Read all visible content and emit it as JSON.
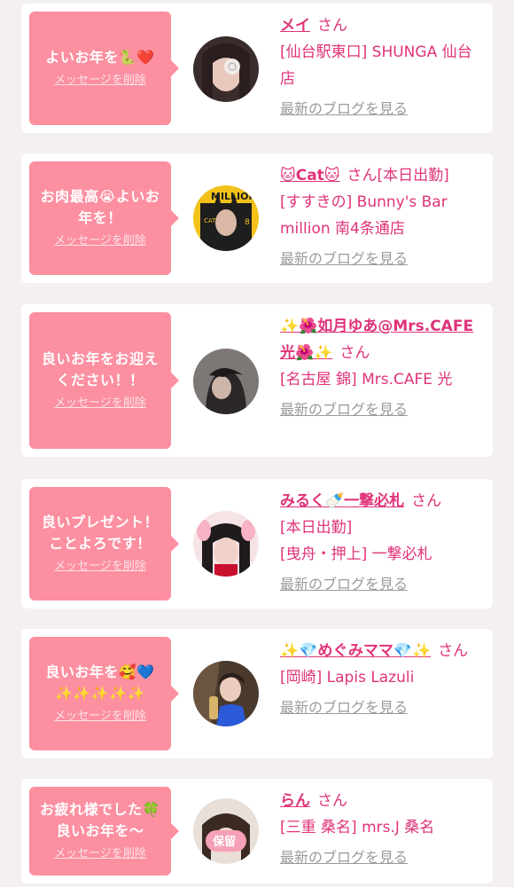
{
  "items": [
    {
      "message": "よいお年を🐍❤️",
      "delete_label": "メッセージを削除",
      "name": "メイ",
      "san": "さん",
      "status": "",
      "shop": "[仙台駅東口] SHUNGA 仙台店",
      "blog_label": "最新のブログを見る",
      "avatar_icon": "profile-photo"
    },
    {
      "message": "お肉最高😭よいお年を！",
      "delete_label": "メッセージを削除",
      "name": "🐱Cat🐱",
      "san": "さん",
      "status": "[本日出勤]",
      "shop": "[すすきの] Bunny's Bar million 南4条通店",
      "blog_label": "最新のブログを見る",
      "avatar_icon": "profile-photo"
    },
    {
      "message": "良いお年をお迎えください！！",
      "delete_label": "メッセージを削除",
      "name": "✨🌺如月ゆあ@Mrs.CAFE光🌺✨",
      "san": "さん",
      "status": "",
      "shop": "[名古屋 錦] Mrs.CAFE 光",
      "blog_label": "最新のブログを見る",
      "avatar_icon": "profile-photo"
    },
    {
      "message": "良いプレゼント！ことよろです！",
      "delete_label": "メッセージを削除",
      "name": "みるく🍼一撃必札",
      "san": "さん",
      "status": "[本日出勤]",
      "shop": "[曳舟・押上] 一撃必札",
      "blog_label": "最新のブログを見る",
      "avatar_icon": "profile-photo"
    },
    {
      "message": "良いお年を🥰💙✨✨✨✨✨",
      "delete_label": "メッセージを削除",
      "name": "✨💎めぐみママ💎✨",
      "san": "さん",
      "status": "",
      "shop": "[岡崎] Lapis Lazuli",
      "blog_label": "最新のブログを見る",
      "avatar_icon": "profile-photo"
    },
    {
      "message": "お疲れ様でした🍀良いお年を〜",
      "delete_label": "メッセージを削除",
      "name": "らん",
      "san": "さん",
      "status": "",
      "shop": "[三重 桑名] mrs.J 桑名",
      "blog_label": "最新のブログを見る",
      "avatar_icon": "profile-photo"
    }
  ],
  "colors": {
    "background": "#f4f0f1",
    "card": "#ffffff",
    "bubble": "#fc8fa0",
    "accent_pink": "#e0337a",
    "link_gray": "#9b9b9b"
  }
}
